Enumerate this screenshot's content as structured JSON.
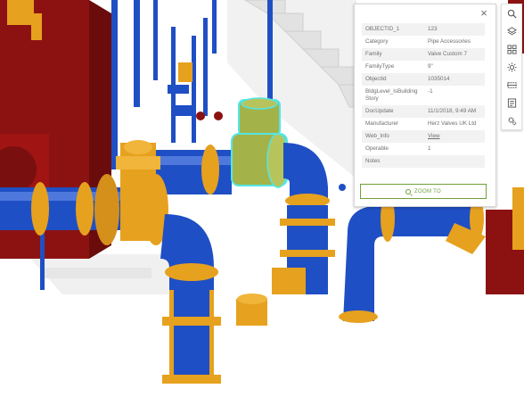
{
  "popup": {
    "close_label": "×",
    "rows": [
      {
        "key": "OBJECTID_1",
        "value": "123"
      },
      {
        "key": "Category",
        "value": "Pipe Accessories"
      },
      {
        "key": "Family",
        "value": "Valve Custom 7"
      },
      {
        "key": "FamilyType",
        "value": "9\""
      },
      {
        "key": "ObjectId",
        "value": "1035014"
      },
      {
        "key": "BldgLevel_IsBuildingStory",
        "value": "-1"
      },
      {
        "key": "DocUpdate",
        "value": "11/1/2018, 9:49 AM"
      },
      {
        "key": "Manufacturer",
        "value": "Herz Valves UK Ltd"
      },
      {
        "key": "Web_Info",
        "value": "View"
      },
      {
        "key": "Operable",
        "value": "1"
      },
      {
        "key": "Notes",
        "value": ""
      }
    ],
    "zoom_label": "ZOOM TO"
  },
  "toolbar": {
    "tools": [
      "search-icon",
      "layers-icon",
      "basemap-gallery-icon",
      "daylight-icon",
      "slice-icon",
      "legend-icon",
      "settings-icon"
    ]
  },
  "colors": {
    "pipe_blue": "#1f4fc4",
    "valve_orange": "#e6a11f",
    "highlight_olive": "#a3b34a",
    "highlight_glow": "#53e6e6",
    "equipment_red": "#8c1212",
    "zoom_green": "#70a13a"
  }
}
